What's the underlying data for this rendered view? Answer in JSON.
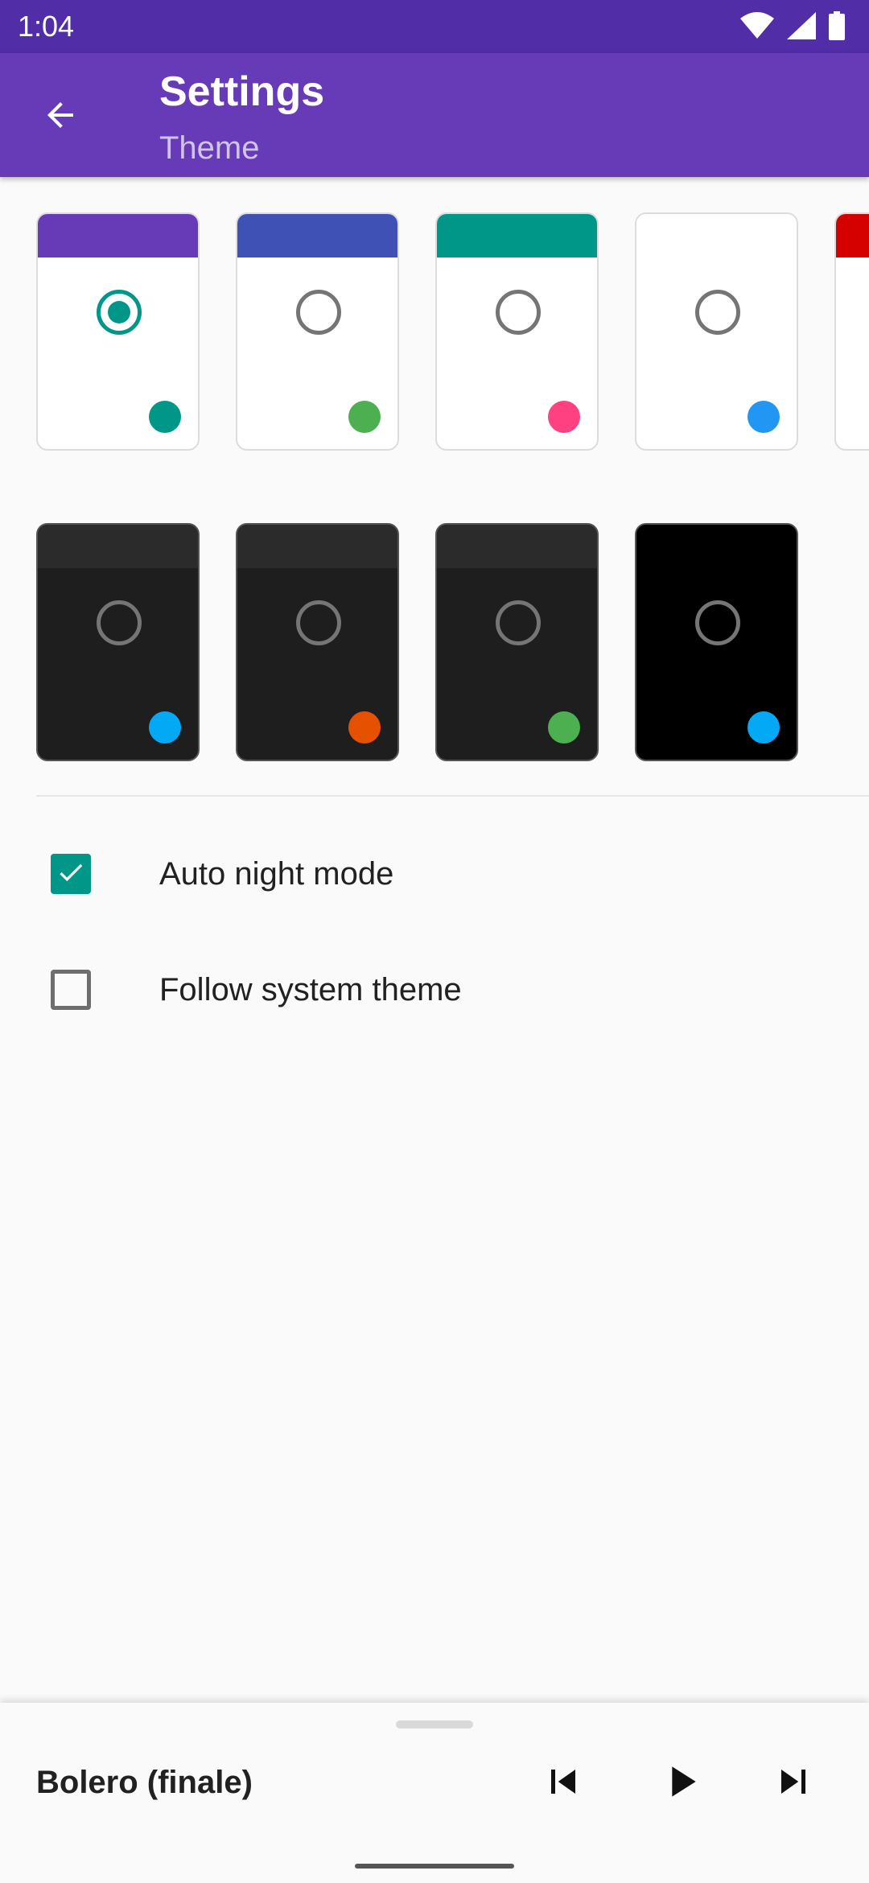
{
  "status_bar": {
    "time": "1:04",
    "icons": [
      "wifi-icon",
      "signal-icon",
      "battery-icon"
    ]
  },
  "app_bar": {
    "title": "Settings",
    "subtitle": "Theme",
    "back_icon": "arrow-back-icon"
  },
  "themes": {
    "light": [
      {
        "header_color": "#673ab7",
        "body_color": "#ffffff",
        "accent_color": "#009688",
        "selected": true
      },
      {
        "header_color": "#3f51b5",
        "body_color": "#ffffff",
        "accent_color": "#4caf50",
        "selected": false
      },
      {
        "header_color": "#009688",
        "body_color": "#ffffff",
        "accent_color": "#ff4081",
        "selected": false
      },
      {
        "header_color": "#ffffff",
        "body_color": "#ffffff",
        "accent_color": "#2196f3",
        "selected": false
      },
      {
        "header_color": "#d50000",
        "body_color": "#ffffff",
        "accent_color": "#ffffff",
        "selected": false
      }
    ],
    "dark": [
      {
        "header_color": "#2b2b2b",
        "body_color": "#1e1e1e",
        "accent_color": "#03a9f4",
        "selected": false
      },
      {
        "header_color": "#2b2b2b",
        "body_color": "#1e1e1e",
        "accent_color": "#e65100",
        "selected": false
      },
      {
        "header_color": "#2b2b2b",
        "body_color": "#1e1e1e",
        "accent_color": "#4caf50",
        "selected": false
      },
      {
        "header_color": "#000000",
        "body_color": "#000000",
        "accent_color": "#03a9f4",
        "selected": false
      }
    ]
  },
  "options": {
    "auto_night_mode": {
      "label": "Auto night mode",
      "checked": true
    },
    "follow_system_theme": {
      "label": "Follow system theme",
      "checked": false
    }
  },
  "player": {
    "track_title": "Bolero (finale)",
    "controls": [
      "skip-previous-icon",
      "play-icon",
      "skip-next-icon"
    ]
  },
  "colors": {
    "status_bar": "#512da8",
    "primary": "#673ab7",
    "accent": "#009688",
    "background": "#fafafa"
  }
}
